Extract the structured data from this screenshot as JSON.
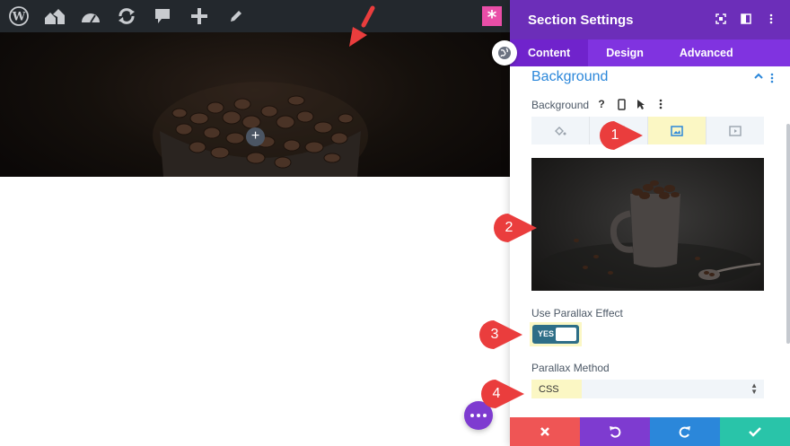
{
  "admin_bar": {
    "icons": [
      "wordpress-icon",
      "my-sites-icon",
      "dashboard-icon",
      "updates-icon",
      "comments-icon",
      "new-icon",
      "edit-icon"
    ]
  },
  "panel": {
    "title": "Section Settings",
    "tabs": [
      {
        "label": "Content",
        "active": true
      },
      {
        "label": "Design",
        "active": false
      },
      {
        "label": "Advanced",
        "active": false
      }
    ],
    "section_title": "Background",
    "background_label": "Background",
    "help_icon_text": "?",
    "background_tabs": [
      "color-icon",
      "gradient-icon",
      "image-icon",
      "video-icon"
    ],
    "active_background_tab": "image-icon",
    "parallax_label": "Use Parallax Effect",
    "parallax_toggle": "YES",
    "parallax_method_label": "Parallax Method",
    "parallax_method_value": "CSS"
  },
  "callouts": [
    "1",
    "2",
    "3",
    "4"
  ],
  "colors": {
    "panel_header": "#6c2eb9",
    "tabs_bar": "#8033e0",
    "accent_blue": "#2b87da",
    "highlight": "#fbf7c4",
    "toggle": "#2e6e87",
    "callout": "#ea3d3d",
    "footer_cancel": "#ef5555",
    "footer_undo": "#7e3bd0",
    "footer_redo": "#2b87da",
    "footer_save": "#29c4a9"
  }
}
